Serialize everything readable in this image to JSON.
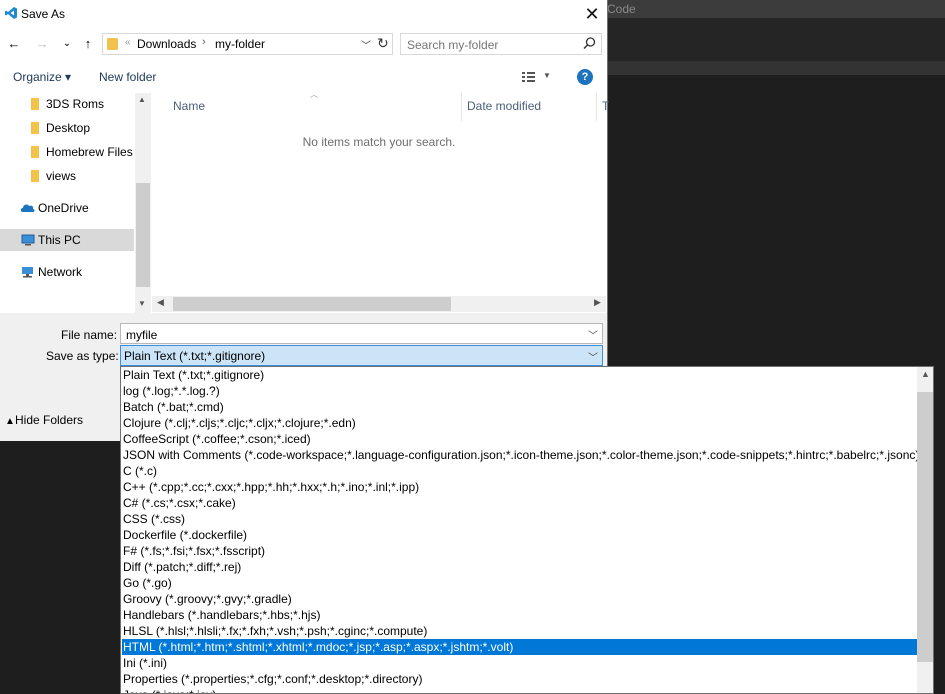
{
  "background": {
    "title_fragment": "Code"
  },
  "dialog": {
    "title": "Save As",
    "nav": {
      "back": "←",
      "forward": "→",
      "recent": "⌄",
      "up": "↑"
    },
    "address": {
      "breadcrumb": [
        "Downloads",
        "my-folder"
      ]
    },
    "search": {
      "placeholder": "Search my-folder"
    },
    "toolbar": {
      "organize": "Organize ▾",
      "new_folder": "New folder",
      "help": "?"
    },
    "nav_pane": {
      "items": [
        {
          "label": "3DS Roms",
          "icon": "folder-icon"
        },
        {
          "label": "Desktop",
          "icon": "folder-icon"
        },
        {
          "label": "Homebrew Files",
          "icon": "folder-icon"
        },
        {
          "label": "views",
          "icon": "folder-icon"
        },
        {
          "label": "OneDrive",
          "icon": "cloud-icon"
        },
        {
          "label": "This PC",
          "icon": "computer-icon",
          "selected": true
        },
        {
          "label": "Network",
          "icon": "network-icon"
        }
      ]
    },
    "file_list": {
      "columns": [
        "Name",
        "Date modified",
        "T"
      ],
      "empty_message": "No items match your search."
    },
    "file_name": {
      "label": "File name:",
      "value": "myfile"
    },
    "save_as_type": {
      "label": "Save as type:",
      "value": "Plain Text (*.txt;*.gitignore)"
    },
    "hide_folders": "Hide Folders"
  },
  "type_options": [
    "Plain Text (*.txt;*.gitignore)",
    "log (*.log;*.*.log.?)",
    "Batch (*.bat;*.cmd)",
    "Clojure (*.clj;*.cljs;*.cljc;*.cljx;*.clojure;*.edn)",
    "CoffeeScript (*.coffee;*.cson;*.iced)",
    "JSON with Comments (*.code-workspace;*.language-configuration.json;*.icon-theme.json;*.color-theme.json;*.code-snippets;*.hintrc;*.babelrc;*.jsonc)",
    "C (*.c)",
    "C++ (*.cpp;*.cc;*.cxx;*.hpp;*.hh;*.hxx;*.h;*.ino;*.inl;*.ipp)",
    "C# (*.cs;*.csx;*.cake)",
    "CSS (*.css)",
    "Dockerfile (*.dockerfile)",
    "F# (*.fs;*.fsi;*.fsx;*.fsscript)",
    "Diff (*.patch;*.diff;*.rej)",
    "Go (*.go)",
    "Groovy (*.groovy;*.gvy;*.gradle)",
    "Handlebars (*.handlebars;*.hbs;*.hjs)",
    "HLSL (*.hlsl;*.hlsli;*.fx;*.fxh;*.vsh;*.psh;*.cginc;*.compute)",
    "HTML (*.html;*.htm;*.shtml;*.xhtml;*.mdoc;*.jsp;*.asp;*.aspx;*.jshtm;*.volt)",
    "Ini (*.ini)",
    "Properties (*.properties;*.cfg;*.conf;*.desktop;*.directory)",
    "Java (*.java;*.jav)"
  ],
  "highlighted_option_index": 17,
  "colors": {
    "selection": "#0078d7",
    "folder": "#f2c24f",
    "help": "#1e73be"
  }
}
